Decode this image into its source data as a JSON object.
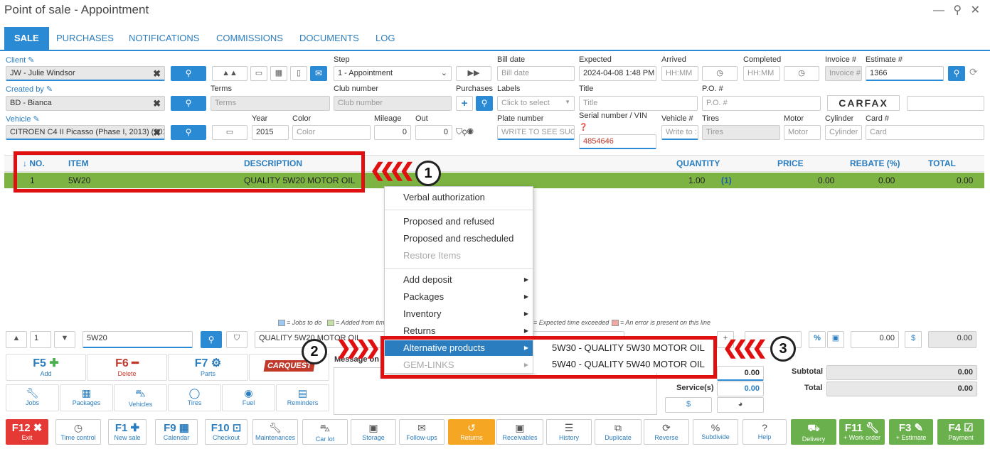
{
  "window": {
    "title": "Point of sale - Appointment",
    "controls": "— ⚲ ✕"
  },
  "tabs": [
    "SALE",
    "PURCHASES",
    "NOTIFICATIONS",
    "COMMISSIONS",
    "DOCUMENTS",
    "LOG"
  ],
  "form": {
    "client_label": "Client",
    "client_value": "JW - Julie Windsor",
    "created_by_label": "Created by",
    "created_by_value": "BD - Bianca",
    "vehicle_label": "Vehicle",
    "vehicle_value": "CITROEN C4 II Picasso (Phase I, 2013) (201",
    "step_label": "Step",
    "step_value": "1 - Appointment",
    "terms_label": "Terms",
    "terms_placeholder": "Terms",
    "club_label": "Club number",
    "club_placeholder": "Club number",
    "purchases_label": "Purchases",
    "year_label": "Year",
    "year_value": "2015",
    "color_label": "Color",
    "color_placeholder": "Color",
    "mileage_label": "Mileage",
    "mileage_value": "0",
    "out_label": "Out",
    "out_value": "0",
    "bill_date_label": "Bill date",
    "bill_date_placeholder": "Bill date",
    "labels_label": "Labels",
    "labels_placeholder": "Click to select",
    "plate_label": "Plate number",
    "plate_placeholder": "WRITE TO SEE SUGG",
    "expected_label": "Expected",
    "expected_value": "2024-04-08 1:48 PM",
    "title_label": "Title",
    "title_placeholder": "Title",
    "serial_label": "Serial number / VIN",
    "serial_value": "4854646",
    "arrived_label": "Arrived",
    "arrived_placeholder": "HH:MM",
    "vehnum_label": "Vehicle #",
    "vehnum_placeholder": "Write to :",
    "completed_label": "Completed",
    "completed_placeholder": "HH:MM",
    "po_label": "P.O. #",
    "po_placeholder": "P.O. #",
    "tires_label": "Tires",
    "tires_placeholder": "Tires",
    "motor_label": "Motor",
    "motor_placeholder": "Motor",
    "invoice_label": "Invoice #",
    "invoice_placeholder": "Invoice #",
    "estimate_label": "Estimate #",
    "estimate_value": "1366",
    "cylinder_label": "Cylinder",
    "cylinder_placeholder": "Cylinder",
    "card_label": "Card #",
    "card_placeholder": "Card",
    "carfax": "CARFAX"
  },
  "table": {
    "headers": {
      "no": "↓ NO.",
      "item": "ITEM",
      "description": "DESCRIPTION",
      "quantity": "QUANTITY",
      "price": "PRICE",
      "rebate": "REBATE (%)",
      "total": "TOTAL"
    },
    "row": {
      "no": "1",
      "item": "5W20",
      "description": "QUALITY 5W20 MOTOR OIL",
      "quantity": "1.00",
      "qty_extra": "(1)",
      "price": "0.00",
      "rebate": "0.00",
      "total": "0.00"
    }
  },
  "context_menu": {
    "items": [
      "Verbal authorization",
      "Proposed and refused",
      "Proposed and rescheduled",
      "Restore Items",
      "Add deposit",
      "Packages",
      "Inventory",
      "Returns",
      "Alternative products",
      "GEM-LINKS"
    ],
    "submenu": [
      "5W30 - QUALITY 5W30 MOTOR OIL",
      "5W40 - QUALITY 5W40 MOTOR OIL"
    ]
  },
  "callouts": [
    "1",
    "2",
    "3"
  ],
  "legend": {
    "a": "= Jobs to do",
    "b": "= Added from tim",
    "c": "= Expected time exceeded",
    "d": "= An error is present on this line"
  },
  "edit": {
    "line": "1",
    "item": "5W20",
    "description": "QUALITY 5W20 MOTOR OIL",
    "amount": "0.00",
    "amount2": "0.00"
  },
  "message_label": "Message on i",
  "totals": {
    "subtotal_label": "Subtotal",
    "subtotal": "0.00",
    "total_label": "Total",
    "total": "0.00",
    "services_label": "Service(s)",
    "services": "0.00",
    "parts": "0.00",
    "dollar": "$"
  },
  "fkeys": [
    {
      "k": "F5",
      "l": "Add"
    },
    {
      "k": "F6",
      "l": "Delete"
    },
    {
      "k": "F7",
      "l": "Parts"
    }
  ],
  "cats": [
    "Jobs",
    "Packages",
    "Vehicles",
    "Tires",
    "Fuel",
    "Reminders"
  ],
  "bottom": [
    {
      "k": "F12",
      "l": "Exit"
    },
    {
      "k": "",
      "l": "Time control"
    },
    {
      "k": "F1",
      "l": "New sale"
    },
    {
      "k": "F9",
      "l": "Calendar"
    },
    {
      "k": "F10",
      "l": "Checkout"
    },
    {
      "k": "",
      "l": "Maintenances"
    },
    {
      "k": "",
      "l": "Car lot"
    },
    {
      "k": "",
      "l": "Storage"
    },
    {
      "k": "",
      "l": "Follow-ups"
    },
    {
      "k": "",
      "l": "Returns"
    },
    {
      "k": "",
      "l": "Receivables"
    },
    {
      "k": "",
      "l": "History"
    },
    {
      "k": "",
      "l": "Duplicate"
    },
    {
      "k": "",
      "l": "Reverse"
    },
    {
      "k": "",
      "l": "Subdivide"
    },
    {
      "k": "",
      "l": "Help"
    },
    {
      "k": "",
      "l": "Delivery"
    },
    {
      "k": "F11",
      "l": "+ Work order"
    },
    {
      "k": "F3",
      "l": "+ Estimate"
    },
    {
      "k": "F4",
      "l": "Payment"
    }
  ]
}
